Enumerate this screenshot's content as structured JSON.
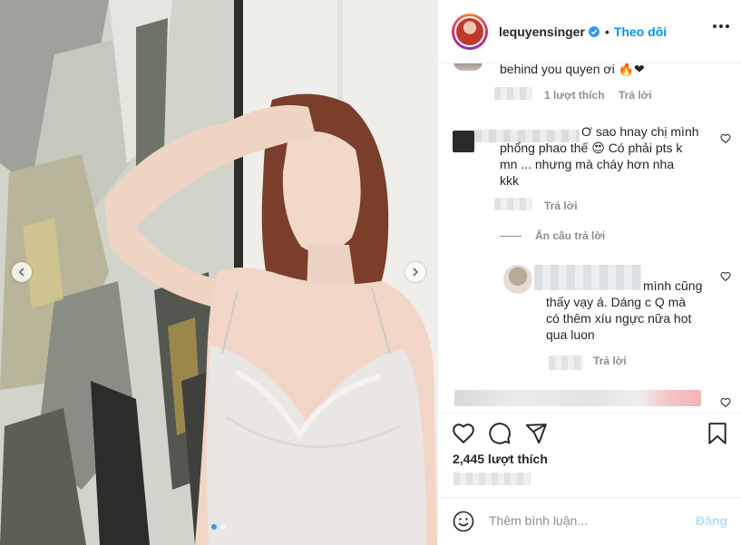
{
  "post": {
    "username": "lequyensinger",
    "separator": "•",
    "follow_label": "Theo dõi"
  },
  "comments": {
    "c0_text": "behind you quyen ơi 🔥❤",
    "c0_likes": "1 lượt thích",
    "c0_reply": "Trả lời",
    "c1_line1": "Ơ sao hnay chị mình",
    "c1_line2": "phổng phao thế 😍 Có phải pts k",
    "c1_line3": "mn ... nhưng mà cháy hơn nha",
    "c1_line4": "kkk",
    "c1_reply": "Trả lời",
    "hide_replies": "Ẩn câu trả lời",
    "r1_line1": "mình cũng",
    "r1_line2": "thấy vạy á. Dáng c Q mà",
    "r1_line3": "có thêm xíu ngực nữa hot",
    "r1_line4": "qua luon",
    "r1_reply": "Trả lời"
  },
  "footer": {
    "likes_count": "2,445 lượt thích",
    "comment_placeholder": "Thêm bình luận...",
    "post_label": "Đăng"
  },
  "icons": {
    "like": "heart-outline-icon",
    "comment": "speech-bubble-icon",
    "share": "paper-plane-icon",
    "save": "bookmark-icon",
    "emoji": "smiley-icon",
    "more": "ellipsis-icon",
    "verified": "verified-badge-icon"
  },
  "colors": {
    "accent": "#0095f6",
    "muted": "#8e8e8e",
    "post_disabled": "#b2dffc"
  },
  "carousel": {
    "slide_count": 2,
    "active_slide": 1
  }
}
